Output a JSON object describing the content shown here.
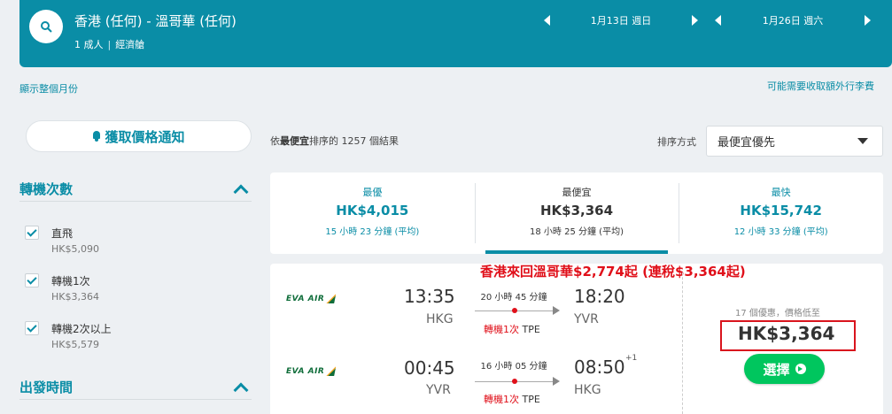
{
  "search": {
    "route": "香港 (任何) - 溫哥華 (任何)",
    "passengers": "1 成人",
    "cabin": "經濟艙",
    "depart_date": "1月13日 週日",
    "return_date": "1月26日 週六"
  },
  "links": {
    "show_month": "顯示整個月份",
    "extra_fees": "可能需要收取額外行李費"
  },
  "alert_button": "獲取價格通知",
  "filters": {
    "stops_title": "轉機次數",
    "stops": [
      {
        "label": "直飛",
        "price": "HK$5,090",
        "checked": true
      },
      {
        "label": "轉機1次",
        "price": "HK$3,364",
        "checked": true
      },
      {
        "label": "轉機2次以上",
        "price": "HK$5,579",
        "checked": true
      }
    ],
    "departure_title": "出發時間"
  },
  "results": {
    "count_prefix": "依",
    "count_bold": "最便宜",
    "count_suffix": "排序的 1257 個結果",
    "sort_label": "排序方式",
    "sort_value": "最便宜優先"
  },
  "summary_tabs": [
    {
      "label": "最優",
      "price": "HK$4,015",
      "time": "15 小時 23 分鐘 (平均)",
      "active": false
    },
    {
      "label": "最便宜",
      "price": "HK$3,364",
      "time": "18 小時 25 分鐘 (平均)",
      "active": true
    },
    {
      "label": "最快",
      "price": "HK$15,742",
      "time": "12 小時 33 分鐘 (平均)",
      "active": false
    }
  ],
  "promo_text": "香港來回溫哥華$2,774起 (連稅$3,364起)",
  "result": {
    "airline": "EVA AIR",
    "outbound": {
      "dep_time": "13:35",
      "dep_airport": "HKG",
      "duration": "20 小時 45 分鐘",
      "arr_time": "18:20",
      "arr_airport": "YVR",
      "stops": "轉機1次",
      "via": "TPE"
    },
    "inbound": {
      "dep_time": "00:45",
      "dep_airport": "YVR",
      "duration": "16 小時 05 分鐘",
      "arr_time": "08:50",
      "arr_day_offset": "+1",
      "arr_airport": "HKG",
      "stops": "轉機1次",
      "via": "TPE"
    },
    "deals": "17 個優惠，價格低至",
    "price": "HK$3,364",
    "select_label": "選擇"
  },
  "colors": {
    "brand": "#0a8da6",
    "promo_red": "#e0101a",
    "select_green": "#00c65e"
  }
}
